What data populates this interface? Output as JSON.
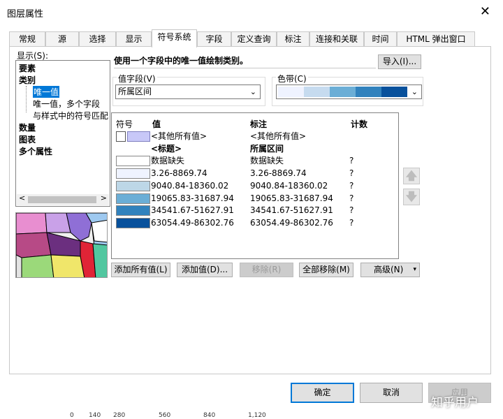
{
  "window": {
    "title": "图层属性",
    "close": "✕"
  },
  "tabs": [
    "常规",
    "源",
    "选择",
    "显示",
    "符号系统",
    "字段",
    "定义查询",
    "标注",
    "连接和关联",
    "时间",
    "HTML 弹出窗口"
  ],
  "active_tab": "符号系统",
  "show": {
    "label": "显示(S):",
    "tree": [
      "要素",
      "类别",
      "唯一值",
      "唯一值，多个字段",
      "与样式中的符号匹配",
      "数量",
      "图表",
      "多个属性"
    ],
    "scroll_left": "<",
    "scroll_right": ">"
  },
  "description": "使用一个字段中的唯一值绘制类别。",
  "import_button": "导入(I)...",
  "value_field": {
    "label": "值字段(V)",
    "value": "所属区间"
  },
  "color_ramp": {
    "label": "色带(C)",
    "colors": [
      "#eff3ff",
      "#c6dbef",
      "#6baed6",
      "#3182bd",
      "#08519c"
    ]
  },
  "table": {
    "headers": {
      "symbol": "符号",
      "value": "值",
      "label": "标注",
      "count": "计数"
    },
    "rows": [
      {
        "value": "<其他所有值>",
        "label": "<其他所有值>",
        "count": "",
        "color": "#c8c8f8",
        "kind": "other"
      },
      {
        "value": "<标题>",
        "label": "所属区间",
        "count": "",
        "color": "",
        "kind": "heading"
      },
      {
        "value": "数据缺失",
        "label": "数据缺失",
        "count": "?",
        "color": "#ffffff",
        "kind": "row"
      },
      {
        "value": "3.26-8869.74",
        "label": "3.26-8869.74",
        "count": "?",
        "color": "#eff3ff",
        "kind": "row"
      },
      {
        "value": "9040.84-18360.02",
        "label": "9040.84-18360.02",
        "count": "?",
        "color": "#bdd7e7",
        "kind": "row"
      },
      {
        "value": "19065.83-31687.94",
        "label": "19065.83-31687.94",
        "count": "?",
        "color": "#6baed6",
        "kind": "row"
      },
      {
        "value": "34541.67-51627.91",
        "label": "34541.67-51627.91",
        "count": "?",
        "color": "#3182bd",
        "kind": "row"
      },
      {
        "value": "63054.49-86302.76",
        "label": "63054.49-86302.76",
        "count": "?",
        "color": "#08519c",
        "kind": "row"
      }
    ]
  },
  "row_buttons": {
    "add_all": "添加所有值(L)",
    "add_values": "添加值(D)...",
    "remove": "移除(R)",
    "remove_all": "全部移除(M)",
    "advanced": "高级(N)"
  },
  "move_up": "🡅",
  "move_down": "🡇",
  "dialog_buttons": {
    "ok": "确定",
    "cancel": "取消",
    "apply": "应用"
  },
  "background_numbers": [
    "0",
    "140",
    "280",
    "560",
    "840",
    "1,120"
  ],
  "watermark": "知乎用户"
}
